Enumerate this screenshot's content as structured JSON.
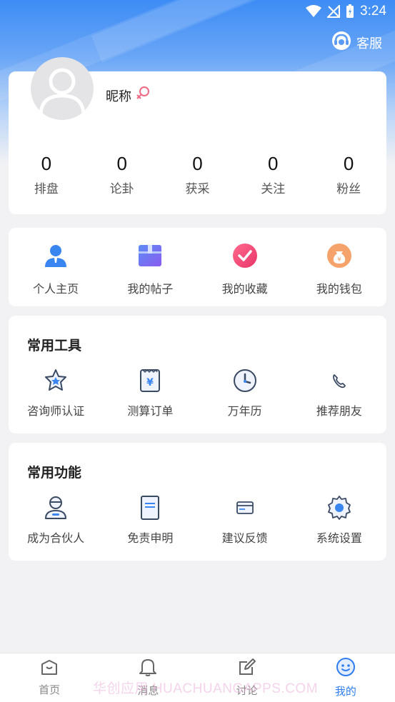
{
  "status_bar": {
    "time": "3:24"
  },
  "header": {
    "service_label": "客服",
    "service_icon": "headset-icon"
  },
  "profile": {
    "nickname": "昵称",
    "gender_icon": "female-icon",
    "stats": [
      {
        "value": "0",
        "label": "排盘"
      },
      {
        "value": "0",
        "label": "论卦"
      },
      {
        "value": "0",
        "label": "获采"
      },
      {
        "value": "0",
        "label": "关注"
      },
      {
        "value": "0",
        "label": "粉丝"
      }
    ]
  },
  "quick_links": [
    {
      "label": "个人主页",
      "icon": "user-icon"
    },
    {
      "label": "我的帖子",
      "icon": "box-icon"
    },
    {
      "label": "我的收藏",
      "icon": "check-circle-icon"
    },
    {
      "label": "我的钱包",
      "icon": "money-bag-icon"
    }
  ],
  "tools": {
    "title": "常用工具",
    "items": [
      {
        "label": "咨询师认证",
        "icon": "star-badge-icon"
      },
      {
        "label": "测算订单",
        "icon": "receipt-icon"
      },
      {
        "label": "万年历",
        "icon": "clock-icon"
      },
      {
        "label": "推荐朋友",
        "icon": "phone-icon"
      }
    ]
  },
  "functions": {
    "title": "常用功能",
    "items": [
      {
        "label": "成为合伙人",
        "icon": "partner-icon"
      },
      {
        "label": "免责申明",
        "icon": "document-icon"
      },
      {
        "label": "建议反馈",
        "icon": "card-icon"
      },
      {
        "label": "系统设置",
        "icon": "gear-icon"
      }
    ]
  },
  "tabbar": {
    "items": [
      {
        "label": "首页",
        "icon": "home-icon",
        "active": false
      },
      {
        "label": "消息",
        "icon": "bell-icon",
        "active": false
      },
      {
        "label": "讨论",
        "icon": "edit-icon",
        "active": false
      },
      {
        "label": "我的",
        "icon": "smile-icon",
        "active": true
      }
    ]
  },
  "watermark": "华创应用 HUACHUANGAPPS.COM",
  "colors": {
    "accent": "#2f7df0",
    "header_blue": "#3d8cf5"
  }
}
